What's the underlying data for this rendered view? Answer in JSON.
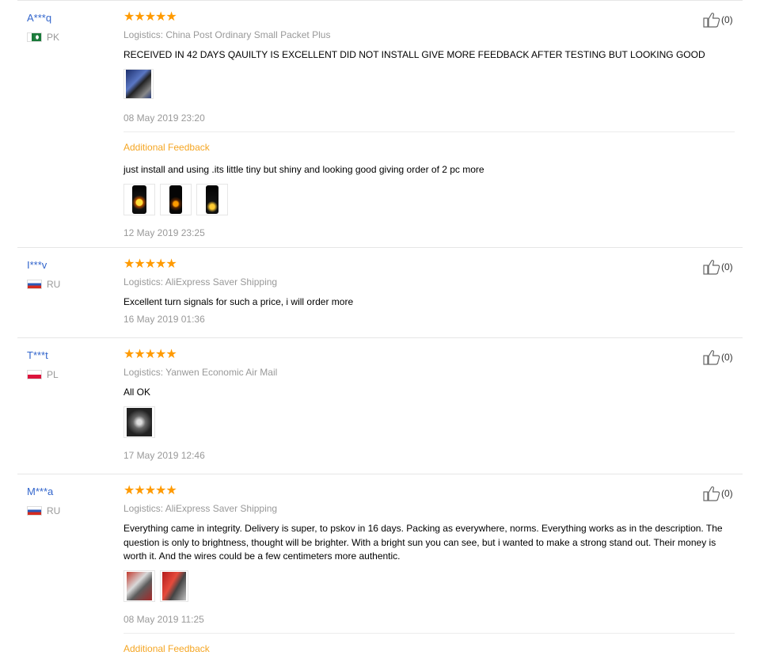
{
  "reviews": [
    {
      "user": "A***q",
      "country": "PK",
      "stars": "★★★★★",
      "logistics": "Logistics: China Post Ordinary Small Packet Plus",
      "content": "RECEIVED IN 42 DAYS QAUILTY IS EXCELLENT DID NOT INSTALL GIVE MORE FEEDBACK AFTER TESTING BUT LOOKING GOOD",
      "date": "08 May 2019 23:20",
      "likes": "(0)",
      "additional_feedback": {
        "label": "Additional Feedback",
        "content": "just install and using .its little tiny but shiny and looking good giving order of 2 pc more",
        "date": "12 May 2019 23:25"
      }
    },
    {
      "user": "I***v",
      "country": "RU",
      "stars": "★★★★★",
      "logistics": "Logistics: AliExpress Saver Shipping",
      "content": "Excellent turn signals for such a price, i will order more",
      "date": "16 May 2019 01:36",
      "likes": "(0)"
    },
    {
      "user": "T***t",
      "country": "PL",
      "stars": "★★★★★",
      "logistics": "Logistics: Yanwen Economic Air Mail",
      "content": "All OK",
      "date": "17 May 2019 12:46",
      "likes": "(0)"
    },
    {
      "user": "M***a",
      "country": "RU",
      "stars": "★★★★★",
      "logistics": "Logistics: AliExpress Saver Shipping",
      "content": "Everything came in integrity. Delivery is super, to pskov in 16 days. Packing as everywhere, norms. Everything works as in the description. The question is only to brightness, thought will be brighter. With a bright sun you can see, but i wanted to make a strong stand out. Their money is worth it. And the wires could be a few centimeters more authentic.",
      "date": "08 May 2019 11:25",
      "likes": "(0)",
      "additional_feedback": {
        "label": "Additional Feedback"
      }
    }
  ],
  "colors": {
    "username": "#3366cc",
    "star": "#ff9a00",
    "muted": "#999999",
    "additional_feedback": "#f5a623"
  },
  "icons": {
    "like": "thumbs-up-icon",
    "flag": "country-flag-icon"
  }
}
